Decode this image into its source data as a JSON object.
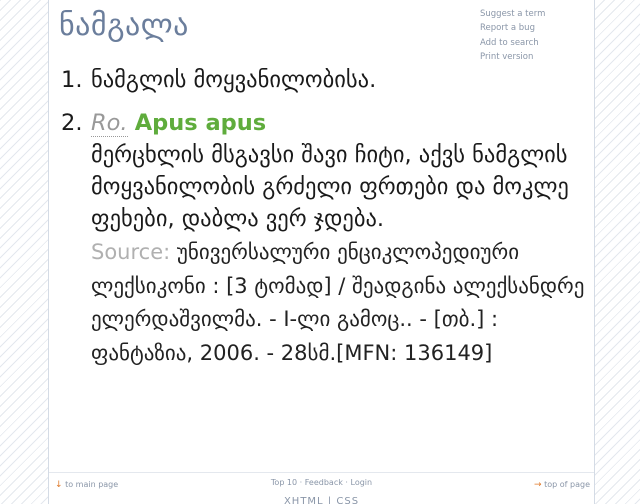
{
  "page_title": "ნამგალა",
  "side_links": [
    "Suggest a term",
    "Report a bug",
    "Add to search",
    "Print version"
  ],
  "definitions": [
    {
      "number": "1.",
      "text": "ნამგლის მოყვანილობისა."
    },
    {
      "number": "2.",
      "abbr": "Ro.",
      "term": "Apus apus",
      "text": "მერცხლის მსგავსი შავი ჩიტი, აქვს ნამგლის მოყვანილობის გრძელი ფრთები და მოკლე ფეხები, დაბლა ვერ ჯდება.",
      "source_label": "Source:",
      "source_text": "უნივერსალური ენციკლოპედიური ლექსიკონი : [3 ტომად] / შეადგინა ალექსანდრე ელერდაშვილმა. - I-ლი გამოც.. - [თბ.] : ფანტაზია, 2006. - 28სმ.[MFN: 136149]"
    }
  ],
  "footer": {
    "main_page": "to main page",
    "top10": "Top 10",
    "sep": "·",
    "feedback": "Feedback",
    "login": "Login",
    "top_of_page": "top of page",
    "bottom": "XHTML | CSS"
  },
  "colors": {
    "title": "#6b7e9c",
    "term": "#5fac3c",
    "muted": "#b0b0b0",
    "link": "#8a96a8"
  }
}
